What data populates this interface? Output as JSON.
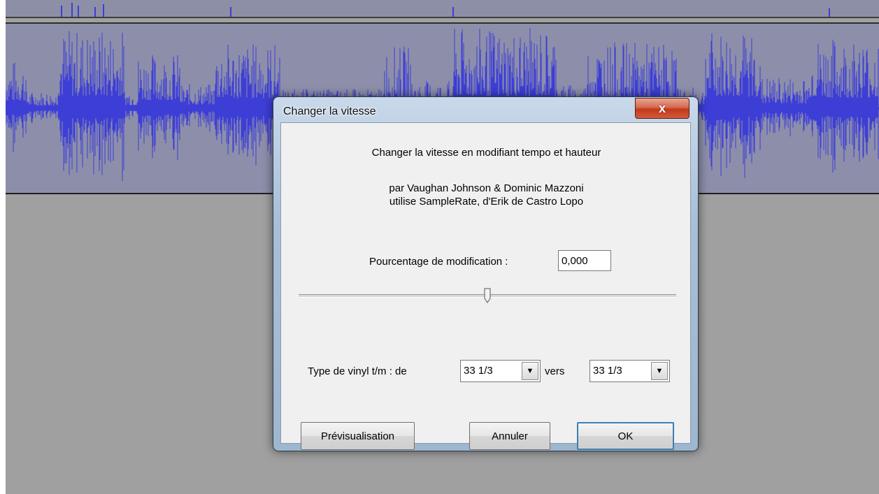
{
  "dialog": {
    "title": "Changer la vitesse",
    "close_label": "x",
    "heading": "Changer la vitesse en modifiant tempo et hauteur",
    "credits_line1": "par Vaughan Johnson & Dominic Mazzoni",
    "credits_line2": "utilise SampleRate, d'Erik de Castro Lopo",
    "percent_label": "Pourcentage de modification :",
    "percent_value": "0,000",
    "slider_position": 0.5,
    "vinyl_label": "Type de vinyl t/m : de",
    "from_rpm": "33 1/3",
    "to_label": "vers",
    "to_rpm": "33 1/3",
    "preview_button": "Prévisualisation",
    "cancel_button": "Annuler",
    "ok_button": "OK"
  },
  "colors": {
    "waveform": "#3d3ed6",
    "track_background": "#8d8faa",
    "workspace": "#a0a0a0"
  }
}
